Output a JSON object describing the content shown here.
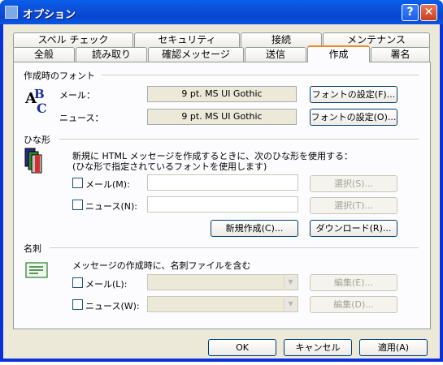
{
  "window": {
    "title": "オプション",
    "help_glyph": "?",
    "close_glyph": "✕"
  },
  "tabs_row1": [
    "スペル チェック",
    "セキュリティ",
    "接続",
    "メンテナンス"
  ],
  "tabs_row2": [
    "全般",
    "読み取り",
    "確認メッセージ",
    "送信",
    "作成",
    "署名"
  ],
  "active_tab": "作成",
  "font_section": {
    "title": "作成時のフォント",
    "mail_label": "メール：",
    "mail_font": "9 pt. MS UI Gothic",
    "mail_button": "フォントの設定(F)...",
    "news_label": "ニュース：",
    "news_font": "9 pt. MS UI Gothic",
    "news_button": "フォントの設定(O)..."
  },
  "stationery_section": {
    "title": "ひな形",
    "desc_line1": "新規に HTML メッセージを作成するときに、次のひな形を使用する：",
    "desc_line2": "(ひな形で指定されているフォントを使用します)",
    "mail_checkbox": "メール(M):",
    "news_checkbox": "ニュース(N):",
    "select_mail_button": "選択(S)...",
    "select_news_button": "選択(T)...",
    "new_button": "新規作成(C)...",
    "download_button": "ダウンロード(R)..."
  },
  "card_section": {
    "title": "名刺",
    "desc": "メッセージの作成時に、名刺ファイルを含む",
    "mail_checkbox": "メール(L):",
    "news_checkbox": "ニュース(W):",
    "edit_mail_button": "編集(E)...",
    "edit_news_button": "編集(D)..."
  },
  "footer": {
    "ok": "OK",
    "cancel": "キャンセル",
    "apply": "適用(A)"
  }
}
